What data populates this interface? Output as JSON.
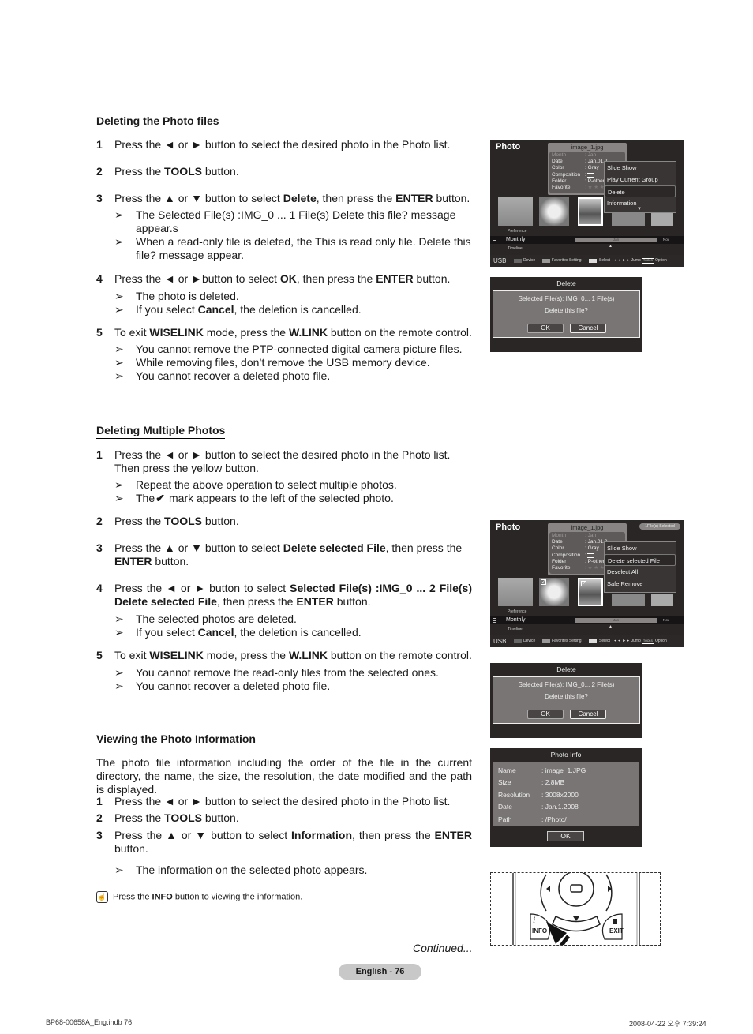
{
  "section1": {
    "heading": "Deleting the Photo files",
    "steps": [
      {
        "num": "1",
        "text": "Press the ◄ or ► button to select the desired photo in the Photo list."
      },
      {
        "num": "2",
        "pre": "Press the ",
        "b1": "TOOLS",
        "post": " button."
      },
      {
        "num": "3",
        "pre": "Press the ▲ or ▼ button to select ",
        "b1": "Delete",
        "mid": ", then press the ",
        "b2": "ENTER",
        "post": " button."
      },
      {
        "num": "4",
        "pre": "Press the ◄ or ►button to select ",
        "b1": "OK",
        "mid": ", then press the ",
        "b2": "ENTER",
        "post": " button."
      },
      {
        "num": "5",
        "pre": "To exit ",
        "b1": "WISELINK",
        "mid": " mode, press the ",
        "b2": "W.LINK",
        "post": " button on the remote control."
      }
    ],
    "notes3": [
      "The Selected File(s) :IMG_0 ... 1 File(s) Delete this file? message appear.s",
      "When a read-only file is deleted, the This is read only file. Delete this file? message appear."
    ],
    "notes4": {
      "n1": "The photo is deleted.",
      "n2_pre": "If you select ",
      "n2_b": "Cancel",
      "n2_post": ", the deletion is cancelled."
    },
    "notes5": [
      "You cannot remove the PTP-connected digital camera picture files.",
      "While removing files, don’t remove the USB memory device.",
      "You cannot recover a deleted photo file."
    ]
  },
  "section2": {
    "heading": "Deleting Multiple Photos",
    "step1": {
      "num": "1",
      "line1": "Press the ◄ or ► button to select the desired photo in the Photo list.",
      "line2": "Then press the yellow button."
    },
    "notes1": {
      "n1": "Repeat the above operation to select multiple photos.",
      "n2_pre": "The",
      "n2_post": " mark appears to the left of the selected photo."
    },
    "step2": {
      "num": "2",
      "pre": "Press the ",
      "b1": "TOOLS",
      "post": " button."
    },
    "step3": {
      "num": "3",
      "pre": "Press the ▲ or ▼ button to select ",
      "b1": "Delete selected File",
      "mid": ", then press the ",
      "b2": "ENTER",
      "post": " button."
    },
    "step4": {
      "num": "4",
      "pre": "Press the ◄ or ► button to select ",
      "b1": "Selected File(s) :IMG_0 ... 2 File(s) Delete selected File",
      "mid": ", then press the ",
      "b2": "ENTER",
      "post": " button."
    },
    "notes4": {
      "n1": "The selected photos are deleted.",
      "n2_pre": "If you select ",
      "n2_b": "Cancel",
      "n2_post": ", the deletion is cancelled."
    },
    "step5": {
      "num": "5",
      "pre": "To exit ",
      "b1": "WISELINK",
      "mid": " mode, press the ",
      "b2": "W.LINK",
      "post": " button on the remote control."
    },
    "notes5": [
      "You cannot remove the read-only files from the selected ones.",
      "You cannot recover a deleted photo file."
    ]
  },
  "section3": {
    "heading": "Viewing the Photo Information",
    "intro": "The photo file information including the order of the file in the current directory, the name, the size, the resolution, the date modified and the path is displayed.",
    "step1": {
      "num": "1",
      "text": "Press the ◄ or ► button to select the desired photo in the Photo list."
    },
    "step2": {
      "num": "2",
      "pre": "Press the ",
      "b1": "TOOLS",
      "post": " button."
    },
    "step3": {
      "num": "3",
      "pre": "Press the ▲ or ▼ button to select  ",
      "b1": "Information",
      "mid": ", then press the ",
      "b2": "ENTER",
      "post": " button."
    },
    "note": "The information on the selected photo appears.",
    "tip": {
      "pre": "Press the ",
      "b": "INFO",
      "post": " button to viewing the information."
    }
  },
  "continued": "Continued...",
  "arrow_glyph": "➢",
  "tv1": {
    "title": "Photo",
    "filename": "image_1.jpg",
    "info": [
      {
        "k": "Month",
        "v": ": Jan"
      },
      {
        "k": "Date",
        "v": ": Jan.01.2"
      },
      {
        "k": "Color",
        "v": ": Gray"
      },
      {
        "k": "Composition",
        "v": ":"
      },
      {
        "k": "Folder",
        "v": ": P-other"
      },
      {
        "k": "Favorite",
        "v": ": ★ ★ ★"
      }
    ],
    "menu": [
      "Slide Show",
      "Play Current Group",
      "Delete",
      "Information"
    ],
    "menu_selected": 2,
    "preference": "Preference",
    "monthly": "Monthly",
    "timeline": "Timeline",
    "bar_month": "Jan",
    "nov": "Nov",
    "bottom": {
      "usb": "USB",
      "device": "Device",
      "fav": "Favorites Setting",
      "select": "Select",
      "jump": "◄◄ ►► Jump",
      "tools": "TOOLS",
      "option": "Option"
    }
  },
  "dialog1": {
    "title": "Delete",
    "line1": "Selected File(s): IMG_0...     1 File(s)",
    "line2": "Delete this file?",
    "ok": "OK",
    "cancel": "Cancel"
  },
  "tv2": {
    "title": "Photo",
    "filename": "image_1.jpg",
    "badge": "1File(s) Selected",
    "info": [
      {
        "k": "Month",
        "v": ": Jan"
      },
      {
        "k": "Date",
        "v": ": Jan.01.2"
      },
      {
        "k": "Color",
        "v": ": Gray"
      },
      {
        "k": "Composition",
        "v": ":"
      },
      {
        "k": "Folder",
        "v": ": P-other"
      },
      {
        "k": "Favorite",
        "v": ": ★ ★ ★"
      }
    ],
    "menu": [
      "Slide Show",
      "Delete selected File",
      "Deselect All",
      "Safe Remove"
    ],
    "menu_selected": 1,
    "preference": "Preference",
    "monthly": "Monthly",
    "timeline": "Timeline",
    "bar_month": "Jan",
    "nov": "Nov",
    "bottom": {
      "usb": "USB",
      "device": "Device",
      "fav": "Favorites Setting",
      "select": "Select",
      "jump": "◄◄ ►► Jump",
      "tools": "TOOLS",
      "option": "Option"
    }
  },
  "dialog2": {
    "title": "Delete",
    "line1": "Selected File(s): IMG_0...     2 File(s)",
    "line2": "Delete this file?",
    "ok": "OK",
    "cancel": "Cancel"
  },
  "photo_info": {
    "title": "Photo Info",
    "rows": [
      {
        "k": "Name",
        "v": ": image_1.JPG"
      },
      {
        "k": "Size",
        "v": ": 2.8MB"
      },
      {
        "k": "Resolution",
        "v": ": 3008x2000"
      },
      {
        "k": "Date",
        "v": ": Jan.1.2008"
      },
      {
        "k": "Path",
        "v": ": /Photo/"
      }
    ],
    "ok": "OK"
  },
  "remote": {
    "info": "INFO",
    "exit": "EXIT",
    "info_glyph": "i"
  },
  "footer": {
    "page": "English - 76",
    "file": "BP68-00658A_Eng.indb   76",
    "timestamp": "2008-04-22   오후 7:39:24"
  },
  "colors": {
    "tv_bg": "#2a2626",
    "menu_bg": "#3a3535",
    "dialog_body": "#7a7575",
    "pill": "#c8c8c8"
  }
}
